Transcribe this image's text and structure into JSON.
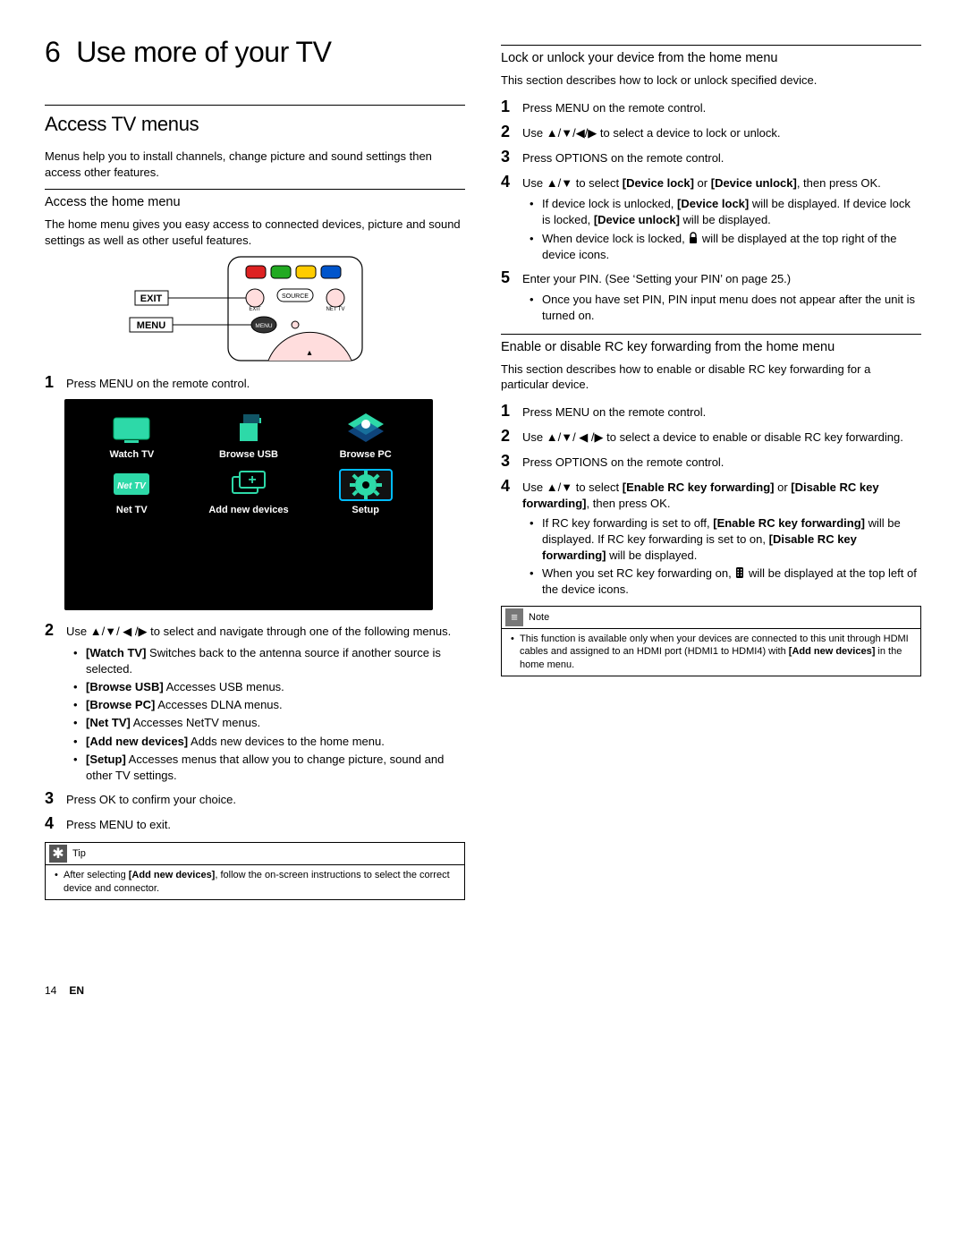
{
  "chapter": {
    "number": "6",
    "title": "Use more of your TV"
  },
  "left": {
    "section_title": "Access TV menus",
    "intro": "Menus help you to install channels, change picture and sound settings then access other features.",
    "sub1_title": "Access the home menu",
    "sub1_intro": "The home menu gives you easy access to connected devices, picture and sound settings as well as other useful features.",
    "remote_labels": {
      "exit": "EXIT",
      "menu": "MENU",
      "source": "SOURCE",
      "nettv": "NET TV"
    },
    "step1": "Press MENU on the remote control.",
    "tiles": {
      "watch": "Watch TV",
      "usb": "Browse USB",
      "pc": "Browse PC",
      "nettv": "Net TV",
      "add": "Add new devices",
      "setup": "Setup"
    },
    "step2_lead": "Use ",
    "step2_arrows": "▲/▼/ ◀ /▶",
    "step2_tail": " to select and navigate through one of the following menus.",
    "bullets": {
      "watch_b": "[Watch TV]",
      "watch_t": " Switches back to the antenna source if another source is selected.",
      "usb_b": "[Browse USB]",
      "usb_t": " Accesses USB menus.",
      "pc_b": "[Browse PC]",
      "pc_t": " Accesses DLNA menus.",
      "net_b": "[Net TV]",
      "net_t": " Accesses NetTV menus.",
      "add_b": "[Add new devices]",
      "add_t": " Adds new devices to the home menu.",
      "setup_b": "[Setup]",
      "setup_t": " Accesses menus that allow you to change picture, sound and other TV settings."
    },
    "step3": "Press OK to confirm your choice.",
    "step4": "Press MENU to exit.",
    "tip_label": "Tip",
    "tip_text_a": "After selecting ",
    "tip_text_b": "[Add new devices]",
    "tip_text_c": ", follow the on-screen instructions to select the correct device and connector."
  },
  "right": {
    "lock_title": "Lock or unlock your device from the home menu",
    "lock_intro": "This section describes how to lock or unlock specified device.",
    "lock_steps": {
      "s1": "Press MENU on the remote control.",
      "s2a": "Use ",
      "s2b": "▲/▼/◀/▶",
      "s2c": " to select a device to lock or unlock.",
      "s3": "Press OPTIONS on the remote control.",
      "s4a": "Use ",
      "s4b": "▲/▼",
      "s4c": " to select ",
      "s4d": "[Device lock]",
      "s4e": " or ",
      "s4f": "[Device unlock]",
      "s4g": ", then press OK.",
      "s4_b1a": "If device lock is unlocked, ",
      "s4_b1b": "[Device lock]",
      "s4_b1c": " will be displayed. If device lock is locked, ",
      "s4_b1d": "[Device unlock]",
      "s4_b1e": " will be displayed.",
      "s4_b2a": "When device lock is locked, ",
      "s4_b2b": " will be displayed at the top right of the device icons.",
      "s5a": "Enter your PIN. (See ‘Setting your PIN’ on page 25.)",
      "s5_b1": "Once you have set PIN, PIN input menu does not appear after the unit is turned on."
    },
    "rc_title": "Enable or disable RC key forwarding from the home menu",
    "rc_intro": "This section describes how to enable or disable RC key forwarding for a particular device.",
    "rc_steps": {
      "s1": "Press MENU on the remote control.",
      "s2a": "Use ",
      "s2b": "▲/▼/ ◀ /▶",
      "s2c": " to select a device to enable or disable RC key forwarding.",
      "s3": "Press OPTIONS on the remote control.",
      "s4a": "Use ",
      "s4b": "▲/▼",
      "s4c": " to select ",
      "s4d": "[Enable RC key forwarding]",
      "s4e": " or ",
      "s4f": "[Disable RC key forwarding]",
      "s4g": ", then press OK.",
      "s4_b1a": "If RC key forwarding is set to off, ",
      "s4_b1b": "[Enable RC key forwarding]",
      "s4_b1c": " will be displayed. If RC key forwarding is set to on, ",
      "s4_b1d": "[Disable RC key forwarding]",
      "s4_b1e": " will be displayed.",
      "s4_b2a": "When you set RC key forwarding on, ",
      "s4_b2b": " will be displayed at the top left of the device icons."
    },
    "note_label": "Note",
    "note_a": "This function is available only when your devices are connected to this unit through HDMI cables and assigned to an HDMI port (HDMI1 to HDMI4) with ",
    "note_b": "[Add new devices]",
    "note_c": " in the home menu."
  },
  "footer": {
    "page": "14",
    "lang": "EN"
  }
}
